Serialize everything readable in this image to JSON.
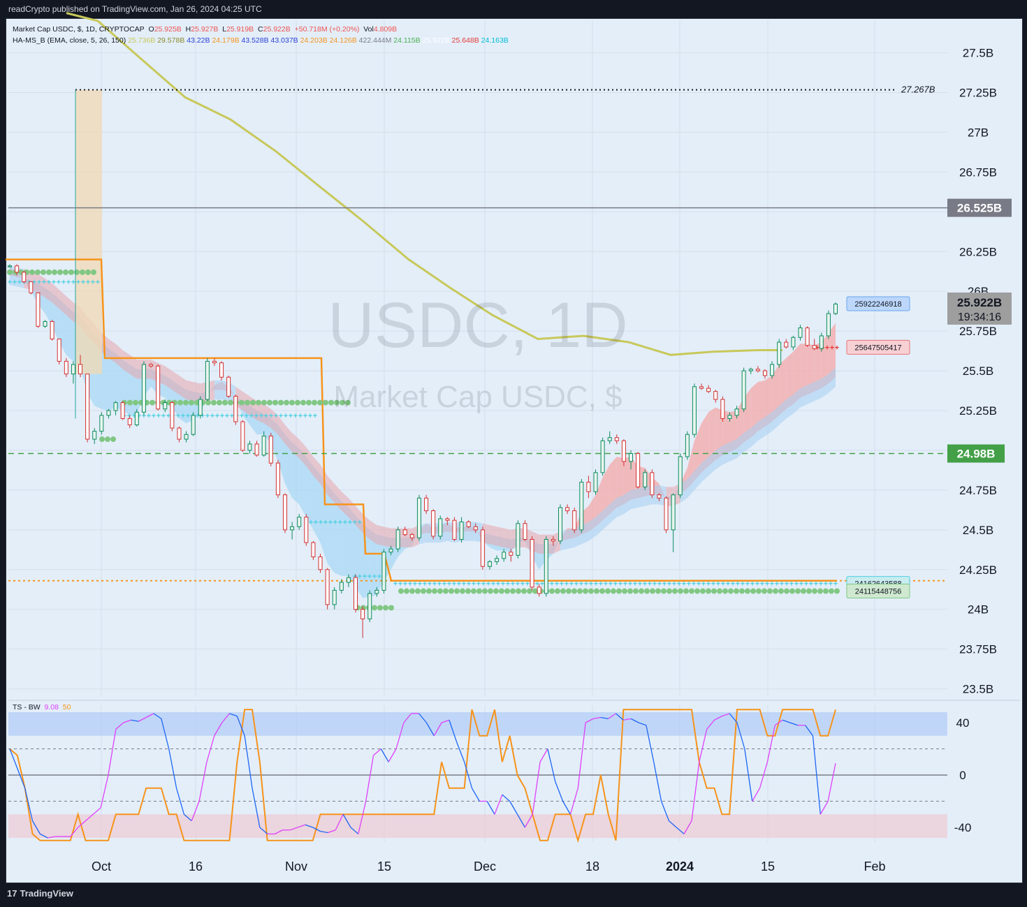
{
  "header": {
    "published": "readCrypto published on TradingView.com, Jan 26, 2024 04:25 UTC"
  },
  "footer": {
    "brand": "TradingView"
  },
  "legend": {
    "main": {
      "symbol": "Market Cap USDC, $, 1D, CRYPTOCAP",
      "o_label": "O",
      "o": "25.925B",
      "h_label": "H",
      "h": "25.927B",
      "l_label": "L",
      "l": "25.919B",
      "c_label": "C",
      "c": "25.922B",
      "chg": "+50.718M (+0.20%)",
      "vol_label": "Vol",
      "vol": "4.809B"
    },
    "indicator": {
      "name": "HA-MS_B (EMA, close, 5, 26, 150)",
      "values": [
        {
          "v": "25.736B",
          "color": "#c8c85a"
        },
        {
          "v": "29.578B",
          "color": "#8a8a2a"
        },
        {
          "v": "43.22B",
          "color": "#2a3fd4"
        },
        {
          "v": "24.179B",
          "color": "#f7931a"
        },
        {
          "v": "43.528B",
          "color": "#2a3fd4"
        },
        {
          "v": "43.037B",
          "color": "#2a3fd4"
        },
        {
          "v": "24.203B",
          "color": "#f7931a"
        },
        {
          "v": "24.126B",
          "color": "#f7931a"
        },
        {
          "v": "422.444M",
          "color": "#787b86"
        },
        {
          "v": "24.115B",
          "color": "#4caf50"
        },
        {
          "v": "25.922B",
          "color": "#ffffff"
        },
        {
          "v": "25.648B",
          "color": "#e53935"
        },
        {
          "v": "24.163B",
          "color": "#00bcd4"
        }
      ]
    },
    "osc": {
      "name": "TS - BW",
      "v1": "9.08",
      "v2": "50",
      "v1_color": "#e040fb",
      "v2_color": "#f7931a"
    }
  },
  "watermark": {
    "title": "USDC, 1D",
    "subtitle": "Market Cap USDC, $"
  },
  "colors": {
    "up": "#26a69a",
    "down": "#ef5350",
    "yellow": "#c8c85a",
    "orange": "#f7931a",
    "green_dot": "#81c784",
    "cyan": "#4dd0e1",
    "pink": "#e040fb",
    "blue": "#1e66f5"
  },
  "price_axis": {
    "ticks": [
      "27.5B",
      "27.25B",
      "27B",
      "26.75B",
      "26.5B",
      "26.25B",
      "26B",
      "25.75B",
      "25.5B",
      "25.25B",
      "25B",
      "24.75B",
      "24.5B",
      "24.25B",
      "24B",
      "23.75B",
      "23.5B"
    ],
    "tick_values": [
      27.5,
      27.25,
      27,
      26.75,
      26.5,
      26.25,
      26,
      25.75,
      25.5,
      25.25,
      25,
      24.75,
      24.5,
      24.25,
      24,
      23.75,
      23.5
    ],
    "badges": {
      "hline": {
        "text": "26.525B",
        "value": 26.525
      },
      "last": {
        "text": "25.922B",
        "value": 25.922,
        "countdown": "19:34:16"
      },
      "green": {
        "text": "24.98B",
        "value": 24.98
      },
      "max": {
        "text": "27.267B",
        "value": 27.267
      }
    },
    "tags": [
      {
        "text": "25922246918",
        "value": 25.922,
        "kind": "blue"
      },
      {
        "text": "25647505417",
        "value": 25.648,
        "kind": "red"
      },
      {
        "text": "24162643588",
        "value": 24.163,
        "kind": "cyan"
      },
      {
        "text": "24115448756",
        "value": 24.115,
        "kind": "green"
      }
    ]
  },
  "osc_axis": {
    "ticks": [
      "40",
      "0",
      "-40"
    ],
    "tick_values": [
      40,
      0,
      -40
    ]
  },
  "time_axis": {
    "labels": [
      {
        "t": "Oct",
        "x": 145
      },
      {
        "t": "16",
        "x": 280
      },
      {
        "t": "Nov",
        "x": 424
      },
      {
        "t": "15",
        "x": 550
      },
      {
        "t": "Dec",
        "x": 694
      },
      {
        "t": "18",
        "x": 848
      },
      {
        "t": "2024",
        "x": 973,
        "bold": true
      },
      {
        "t": "15",
        "x": 1099
      },
      {
        "t": "Feb",
        "x": 1252
      }
    ]
  },
  "chart_data": {
    "type": "candlestick",
    "ylim": [
      23.45,
      27.7
    ],
    "osc_ylim": [
      -48,
      48
    ],
    "candles": [
      [
        26.16,
        26.17,
        26.15,
        26.16
      ],
      [
        26.16,
        26.17,
        26.1,
        26.12
      ],
      [
        26.12,
        26.13,
        26.05,
        26.06
      ],
      [
        26.06,
        26.06,
        25.98,
        25.99
      ],
      [
        25.99,
        25.99,
        25.77,
        25.78
      ],
      [
        25.78,
        25.82,
        25.77,
        25.81
      ],
      [
        25.81,
        25.82,
        25.69,
        25.7
      ],
      [
        25.7,
        25.7,
        25.54,
        25.56
      ],
      [
        25.56,
        25.58,
        25.46,
        25.48
      ],
      [
        25.48,
        25.56,
        25.42,
        25.54
      ],
      [
        25.54,
        25.6,
        25.46,
        25.48
      ],
      [
        25.48,
        25.48,
        25.05,
        25.07
      ],
      [
        25.07,
        25.14,
        25.04,
        25.12
      ],
      [
        25.12,
        25.24,
        25.1,
        25.22
      ],
      [
        25.22,
        25.26,
        25.2,
        25.25
      ],
      [
        25.25,
        25.31,
        25.22,
        25.3
      ],
      [
        25.3,
        25.31,
        25.19,
        25.2
      ],
      [
        25.2,
        25.22,
        25.14,
        25.16
      ],
      [
        25.16,
        25.26,
        25.15,
        25.24
      ],
      [
        25.24,
        25.56,
        25.22,
        25.54
      ],
      [
        25.54,
        25.55,
        25.52,
        25.53
      ],
      [
        25.53,
        25.54,
        25.25,
        25.26
      ],
      [
        25.26,
        25.32,
        25.24,
        25.3
      ],
      [
        25.3,
        25.31,
        25.12,
        25.14
      ],
      [
        25.14,
        25.15,
        25.05,
        25.07
      ],
      [
        25.07,
        25.12,
        25.05,
        25.1
      ],
      [
        25.1,
        25.24,
        25.09,
        25.22
      ],
      [
        25.22,
        25.34,
        25.2,
        25.32
      ],
      [
        25.32,
        25.58,
        25.31,
        25.56
      ],
      [
        25.56,
        25.58,
        25.53,
        25.55
      ],
      [
        25.55,
        25.56,
        25.44,
        25.46
      ],
      [
        25.46,
        25.47,
        25.33,
        25.34
      ],
      [
        25.34,
        25.35,
        25.16,
        25.18
      ],
      [
        25.18,
        25.19,
        24.99,
        25.0
      ],
      [
        25.0,
        25.06,
        24.98,
        25.04
      ],
      [
        25.04,
        25.06,
        24.96,
        24.97
      ],
      [
        24.97,
        25.12,
        24.96,
        25.09
      ],
      [
        25.09,
        25.11,
        24.9,
        24.92
      ],
      [
        24.92,
        24.94,
        24.7,
        24.72
      ],
      [
        24.72,
        24.73,
        24.48,
        24.5
      ],
      [
        24.5,
        24.55,
        24.44,
        24.52
      ],
      [
        24.52,
        24.6,
        24.5,
        24.58
      ],
      [
        24.58,
        24.6,
        24.4,
        24.42
      ],
      [
        24.42,
        24.43,
        24.31,
        24.33
      ],
      [
        24.33,
        24.35,
        24.23,
        24.25
      ],
      [
        24.25,
        24.26,
        24.0,
        24.03
      ],
      [
        24.03,
        24.14,
        24.0,
        24.12
      ],
      [
        24.12,
        24.19,
        24.1,
        24.17
      ],
      [
        24.17,
        24.22,
        24.14,
        24.2
      ],
      [
        24.2,
        24.22,
        23.98,
        24.0
      ],
      [
        24.0,
        24.02,
        23.82,
        23.94
      ],
      [
        23.94,
        24.12,
        23.92,
        24.1
      ],
      [
        24.1,
        24.14,
        24.08,
        24.12
      ],
      [
        24.12,
        24.38,
        24.1,
        24.36
      ],
      [
        24.36,
        24.4,
        24.34,
        24.38
      ],
      [
        24.38,
        24.52,
        24.36,
        24.5
      ],
      [
        24.5,
        24.52,
        24.46,
        24.47
      ],
      [
        24.47,
        24.48,
        24.43,
        24.45
      ],
      [
        24.45,
        24.72,
        24.43,
        24.7
      ],
      [
        24.7,
        24.72,
        24.6,
        24.62
      ],
      [
        24.62,
        24.63,
        24.44,
        24.46
      ],
      [
        24.46,
        24.59,
        24.44,
        24.57
      ],
      [
        24.57,
        24.58,
        24.53,
        24.56
      ],
      [
        24.56,
        24.58,
        24.43,
        24.44
      ],
      [
        24.44,
        24.58,
        24.42,
        24.55
      ],
      [
        24.55,
        24.56,
        24.51,
        24.52
      ],
      [
        24.52,
        24.54,
        24.48,
        24.5
      ],
      [
        24.5,
        24.52,
        24.25,
        24.27
      ],
      [
        24.27,
        24.31,
        24.25,
        24.3
      ],
      [
        24.3,
        24.34,
        24.28,
        24.32
      ],
      [
        24.32,
        24.38,
        24.3,
        24.36
      ],
      [
        24.36,
        24.38,
        24.3,
        24.34
      ],
      [
        24.34,
        24.56,
        24.32,
        24.54
      ],
      [
        24.54,
        24.56,
        24.43,
        24.44
      ],
      [
        24.44,
        24.46,
        24.12,
        24.14
      ],
      [
        24.14,
        24.16,
        24.08,
        24.1
      ],
      [
        24.1,
        24.46,
        24.08,
        24.44
      ],
      [
        24.44,
        24.46,
        24.4,
        24.43
      ],
      [
        24.43,
        24.66,
        24.41,
        24.64
      ],
      [
        24.64,
        24.66,
        24.6,
        24.62
      ],
      [
        24.62,
        24.64,
        24.48,
        24.5
      ],
      [
        24.5,
        24.82,
        24.48,
        24.8
      ],
      [
        24.8,
        24.84,
        24.7,
        24.74
      ],
      [
        24.74,
        24.88,
        24.72,
        24.86
      ],
      [
        24.86,
        25.08,
        24.84,
        25.06
      ],
      [
        25.06,
        25.12,
        25.04,
        25.08
      ],
      [
        25.08,
        25.1,
        25.04,
        25.06
      ],
      [
        25.06,
        25.07,
        24.9,
        24.93
      ],
      [
        24.93,
        25.0,
        24.88,
        24.98
      ],
      [
        24.98,
        24.99,
        24.76,
        24.77
      ],
      [
        24.77,
        24.88,
        24.75,
        24.86
      ],
      [
        24.86,
        24.88,
        24.7,
        24.72
      ],
      [
        24.72,
        24.73,
        24.68,
        24.7
      ],
      [
        24.7,
        24.71,
        24.48,
        24.5
      ],
      [
        24.5,
        24.73,
        24.36,
        24.72
      ],
      [
        24.72,
        24.98,
        24.7,
        24.96
      ],
      [
        24.96,
        25.12,
        24.94,
        25.1
      ],
      [
        25.1,
        25.42,
        25.08,
        25.4
      ],
      [
        25.4,
        25.42,
        25.38,
        25.39
      ],
      [
        25.39,
        25.41,
        25.36,
        25.37
      ],
      [
        25.37,
        25.38,
        25.3,
        25.32
      ],
      [
        25.32,
        25.34,
        25.18,
        25.2
      ],
      [
        25.2,
        25.24,
        25.18,
        25.22
      ],
      [
        25.22,
        25.28,
        25.2,
        25.26
      ],
      [
        25.26,
        25.52,
        25.24,
        25.5
      ],
      [
        25.5,
        25.52,
        25.48,
        25.51
      ],
      [
        25.51,
        25.53,
        25.49,
        25.5
      ],
      [
        25.5,
        25.51,
        25.45,
        25.47
      ],
      [
        25.47,
        25.56,
        25.45,
        25.54
      ],
      [
        25.54,
        25.7,
        25.52,
        25.68
      ],
      [
        25.68,
        25.7,
        25.64,
        25.65
      ],
      [
        25.65,
        25.72,
        25.63,
        25.71
      ],
      [
        25.71,
        25.79,
        25.69,
        25.77
      ],
      [
        25.77,
        25.78,
        25.65,
        25.66
      ],
      [
        25.66,
        25.7,
        25.63,
        25.64
      ],
      [
        25.64,
        25.74,
        25.62,
        25.72
      ],
      [
        25.72,
        25.88,
        25.7,
        25.86
      ],
      [
        25.86,
        25.93,
        25.85,
        25.92
      ]
    ],
    "ema_fast": [
      26.15,
      26.12,
      26.07,
      26.0,
      25.92,
      25.86,
      25.78,
      25.68,
      25.6,
      25.56,
      25.52,
      25.36,
      25.28,
      25.26,
      25.25,
      25.27,
      25.25,
      25.22,
      25.23,
      25.34,
      25.4,
      25.35,
      25.33,
      25.27,
      25.2,
      25.17,
      25.19,
      25.23,
      25.34,
      25.41,
      25.43,
      25.4,
      25.33,
      25.22,
      25.16,
      25.1,
      25.1,
      25.04,
      24.93,
      24.79,
      24.7,
      24.66,
      24.58,
      24.5,
      24.42,
      24.29,
      24.23,
      24.21,
      24.21,
      24.14,
      24.07,
      24.08,
      24.09,
      24.18,
      24.25,
      24.33,
      24.38,
      24.4,
      24.5,
      24.54,
      24.51,
      24.53,
      24.54,
      24.51,
      24.52,
      24.52,
      24.51,
      24.43,
      24.39,
      24.37,
      24.37,
      24.36,
      24.42,
      24.43,
      24.33,
      24.25,
      24.31,
      24.35,
      24.45,
      24.51,
      24.51,
      24.61,
      24.65,
      24.72,
      24.83,
      24.91,
      24.96,
      24.95,
      24.96,
      24.9,
      24.89,
      24.83,
      24.79,
      24.69,
      24.7,
      24.79,
      24.89,
      25.06,
      25.17,
      25.24,
      25.27,
      25.25,
      25.24,
      25.25,
      25.33,
      25.39,
      25.43,
      25.44,
      25.47,
      25.54,
      25.58,
      25.62,
      25.67,
      25.67,
      25.66,
      25.68,
      25.74,
      25.8
    ],
    "ema_slow": [
      26.1,
      26.09,
      26.08,
      26.07,
      26.05,
      26.02,
      25.99,
      25.95,
      25.91,
      25.87,
      25.84,
      25.78,
      25.73,
      25.68,
      25.64,
      25.61,
      25.57,
      25.54,
      25.51,
      25.51,
      25.51,
      25.49,
      25.47,
      25.44,
      25.41,
      25.38,
      25.37,
      25.36,
      25.37,
      25.38,
      25.38,
      25.37,
      25.34,
      25.31,
      25.28,
      25.25,
      25.23,
      25.2,
      25.16,
      25.1,
      25.05,
      25.01,
      24.96,
      24.9,
      24.85,
      24.78,
      24.73,
      24.68,
      24.64,
      24.59,
      24.54,
      24.5,
      24.47,
      24.46,
      24.45,
      24.45,
      24.45,
      24.45,
      24.47,
      24.48,
      24.48,
      24.48,
      24.49,
      24.48,
      24.49,
      24.49,
      24.49,
      24.48,
      24.47,
      24.46,
      24.45,
      24.44,
      24.45,
      24.45,
      24.43,
      24.41,
      24.41,
      24.41,
      24.43,
      24.44,
      24.45,
      24.47,
      24.49,
      24.52,
      24.56,
      24.6,
      24.64,
      24.66,
      24.69,
      24.7,
      24.71,
      24.72,
      24.72,
      24.71,
      24.71,
      24.73,
      24.76,
      24.81,
      24.86,
      24.9,
      24.94,
      24.97,
      24.99,
      25.01,
      25.05,
      25.08,
      25.12,
      25.15,
      25.18,
      25.22,
      25.26,
      25.29,
      25.33,
      25.35,
      25.37,
      25.39,
      25.42,
      25.46
    ],
    "step_yellow": [
      [
        95,
        27.75
      ],
      [
        140,
        27.7
      ],
      [
        205,
        27.45
      ],
      [
        265,
        27.22
      ],
      [
        330,
        27.08
      ],
      [
        395,
        26.88
      ],
      [
        460,
        26.65
      ],
      [
        520,
        26.44
      ],
      [
        585,
        26.2
      ],
      [
        645,
        26.02
      ],
      [
        705,
        25.85
      ],
      [
        770,
        25.7
      ],
      [
        835,
        25.72
      ],
      [
        900,
        25.68
      ],
      [
        960,
        25.6
      ],
      [
        1020,
        25.62
      ],
      [
        1085,
        25.63
      ],
      [
        1120,
        25.63
      ]
    ],
    "step_orange": [
      [
        8,
        26.2
      ],
      [
        145,
        26.2
      ],
      [
        150,
        25.58
      ],
      [
        460,
        25.58
      ],
      [
        465,
        24.66
      ],
      [
        520,
        24.66
      ],
      [
        523,
        24.35
      ],
      [
        550,
        24.35
      ],
      [
        560,
        24.18
      ],
      [
        1198,
        24.18
      ]
    ],
    "tsbw_fast": [
      20,
      5,
      -10,
      -35,
      -45,
      -48,
      -47,
      -47,
      -47,
      -40,
      -35,
      -30,
      -25,
      0,
      35,
      40,
      42,
      41,
      44,
      47,
      43,
      20,
      -10,
      -30,
      -35,
      -20,
      10,
      30,
      40,
      47,
      45,
      30,
      -10,
      -40,
      -45,
      -45,
      -42,
      -42,
      -40,
      -38,
      -40,
      -43,
      -44,
      -42,
      -30,
      -40,
      -45,
      -20,
      15,
      20,
      10,
      20,
      40,
      47,
      47,
      40,
      30,
      40,
      42,
      25,
      10,
      -10,
      -20,
      -20,
      -30,
      -15,
      -20,
      -30,
      -40,
      -30,
      10,
      20,
      -5,
      -20,
      -30,
      -10,
      40,
      43,
      44,
      43,
      47,
      42,
      43,
      40,
      38,
      10,
      -20,
      -35,
      -40,
      -45,
      -35,
      10,
      35,
      42,
      45,
      47,
      40,
      20,
      -20,
      -10,
      10,
      38,
      42,
      40,
      38,
      38,
      30,
      -30,
      -20,
      9
    ],
    "tsbw_slow": [
      20,
      15,
      -10,
      -45,
      -50,
      -50,
      -50,
      -50,
      -50,
      -30,
      -50,
      -50,
      -50,
      -50,
      -30,
      -30,
      -30,
      -30,
      -10,
      -10,
      -10,
      -30,
      -30,
      -50,
      -50,
      -50,
      -50,
      -50,
      -50,
      -50,
      10,
      50,
      50,
      10,
      -50,
      -50,
      -50,
      -50,
      -50,
      -50,
      -50,
      -30,
      -30,
      -30,
      -30,
      -30,
      -30,
      -30,
      -30,
      -30,
      -30,
      -30,
      -30,
      -30,
      -30,
      -30,
      -30,
      10,
      -10,
      -10,
      -10,
      50,
      30,
      30,
      50,
      10,
      30,
      0,
      -10,
      -30,
      -50,
      -50,
      -30,
      -30,
      -30,
      -50,
      -30,
      -30,
      0,
      -30,
      -50,
      50,
      50,
      50,
      50,
      50,
      50,
      50,
      50,
      50,
      50,
      10,
      -10,
      -10,
      -30,
      -30,
      50,
      50,
      50,
      50,
      30,
      30,
      50,
      50,
      50,
      50,
      50,
      30,
      30,
      50
    ]
  }
}
